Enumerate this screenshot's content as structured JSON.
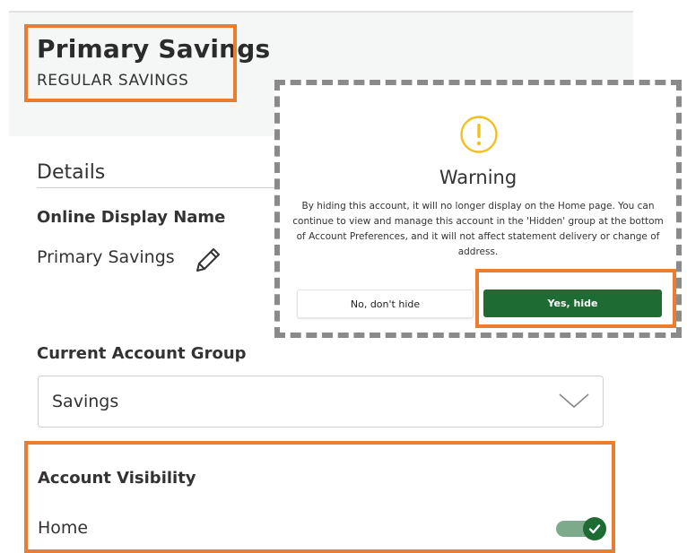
{
  "account": {
    "name": "Primary Savings",
    "type": "REGULAR SAVINGS"
  },
  "details": {
    "section_title": "Details",
    "display_name_label": "Online Display Name",
    "display_name_value": "Primary Savings",
    "edit_icon": "pencil-icon"
  },
  "group": {
    "label": "Current Account Group",
    "selected": "Savings",
    "dropdown_icon": "chevron-down-icon"
  },
  "visibility": {
    "label": "Account Visibility",
    "home_label": "Home",
    "home_enabled": true
  },
  "modal": {
    "icon": "warning-icon",
    "title": "Warning",
    "body": "By hiding this account, it will no longer display on the Home page. You can continue to view and manage this account in the 'Hidden' group at the bottom of Account Preferences, and it will not affect statement delivery or change of address.",
    "cancel_label": "No, don't hide",
    "confirm_label": "Yes, hide"
  },
  "colors": {
    "highlight": "#ec7c30",
    "brand_green": "#1e6b33",
    "warning_yellow": "#f0c020"
  }
}
